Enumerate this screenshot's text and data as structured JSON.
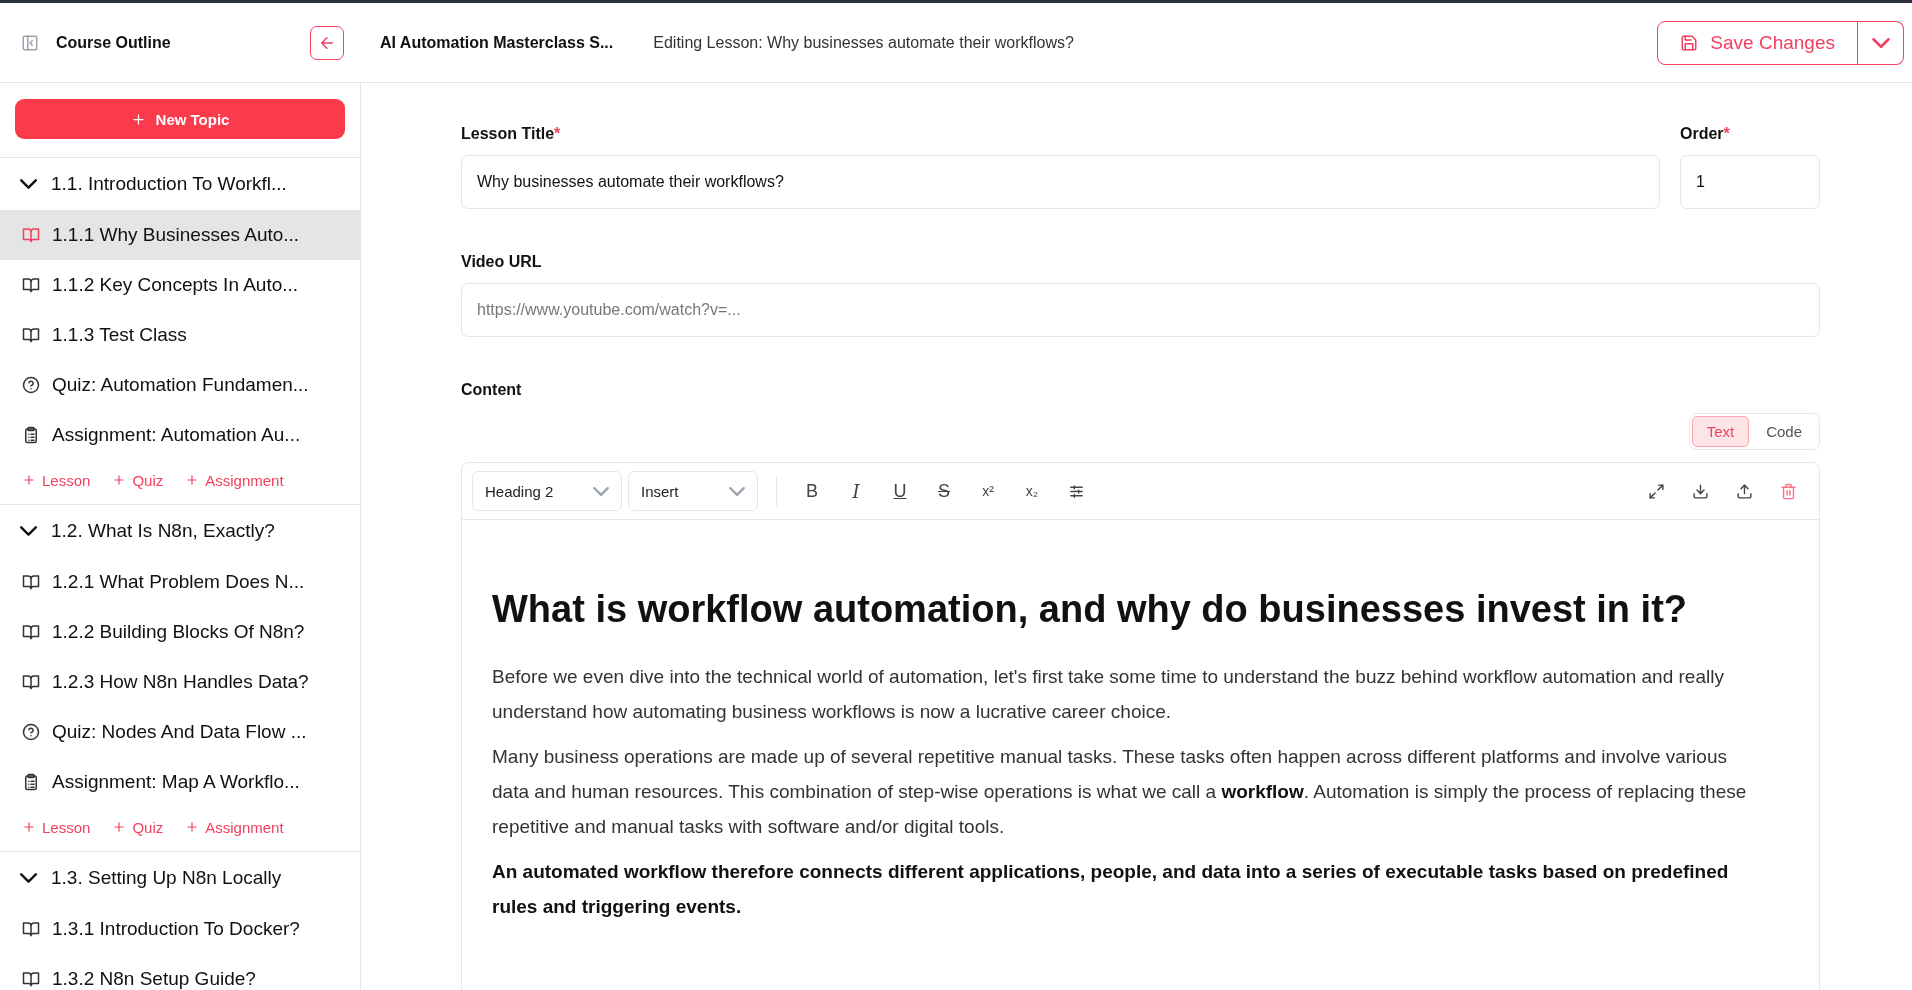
{
  "header": {
    "outline_title": "Course Outline",
    "course_title": "AI Automation Masterclass S...",
    "editing_label": "Editing Lesson: Why businesses automate their workflows?",
    "save_button": "Save Changes"
  },
  "sidebar": {
    "new_topic_button": "New Topic",
    "topics": [
      {
        "title": "1.1. Introduction To Workfl...",
        "expanded": true,
        "items": [
          {
            "kind": "lesson",
            "title": "1.1.1 Why Businesses Auto...",
            "selected": true
          },
          {
            "kind": "lesson",
            "title": "1.1.2 Key Concepts In Auto...",
            "selected": false
          },
          {
            "kind": "lesson",
            "title": "1.1.3 Test Class",
            "selected": false
          },
          {
            "kind": "quiz",
            "title": "Quiz: Automation Fundamen...",
            "selected": false
          },
          {
            "kind": "assignment",
            "title": "Assignment: Automation Au...",
            "selected": false
          }
        ],
        "add_actions": [
          "Lesson",
          "Quiz",
          "Assignment"
        ]
      },
      {
        "title": "1.2. What Is N8n, Exactly?",
        "expanded": true,
        "items": [
          {
            "kind": "lesson",
            "title": "1.2.1 What Problem Does N...",
            "selected": false
          },
          {
            "kind": "lesson",
            "title": "1.2.2 Building Blocks Of N8n?",
            "selected": false
          },
          {
            "kind": "lesson",
            "title": "1.2.3 How N8n Handles Data?",
            "selected": false
          },
          {
            "kind": "quiz",
            "title": "Quiz: Nodes And Data Flow ...",
            "selected": false
          },
          {
            "kind": "assignment",
            "title": "Assignment: Map A Workflo...",
            "selected": false
          }
        ],
        "add_actions": [
          "Lesson",
          "Quiz",
          "Assignment"
        ]
      },
      {
        "title": "1.3. Setting Up N8n Locally",
        "expanded": true,
        "items": [
          {
            "kind": "lesson",
            "title": "1.3.1 Introduction To Docker?",
            "selected": false
          },
          {
            "kind": "lesson",
            "title": "1.3.2 N8n Setup Guide?",
            "selected": false
          }
        ]
      }
    ]
  },
  "form": {
    "lesson_title": {
      "label": "Lesson Title",
      "required_mark": "*",
      "value": "Why businesses automate their workflows?"
    },
    "order": {
      "label": "Order",
      "required_mark": "*",
      "value": "1"
    },
    "video_url": {
      "label": "Video URL",
      "placeholder": "https://www.youtube.com/watch?v=..."
    },
    "content_label": "Content"
  },
  "editor": {
    "modes": [
      {
        "label": "Text",
        "selected": true
      },
      {
        "label": "Code",
        "selected": false
      }
    ],
    "dropdowns": [
      "Heading 2",
      "Insert"
    ],
    "format_buttons": [
      {
        "kind": "bold",
        "glyph": "B"
      },
      {
        "kind": "italic",
        "glyph": "I"
      },
      {
        "kind": "underline",
        "glyph": "U"
      },
      {
        "kind": "strike",
        "glyph": "S"
      },
      {
        "kind": "superscript",
        "glyph": "x²"
      },
      {
        "kind": "subscript",
        "glyph": "x₂"
      },
      {
        "kind": "settings"
      }
    ],
    "action_buttons": [
      {
        "kind": "fullscreen"
      },
      {
        "kind": "download"
      },
      {
        "kind": "upload"
      },
      {
        "kind": "delete"
      }
    ],
    "content": [
      {
        "kind": "heading",
        "text": "What is workflow automation, and why do businesses invest in it?"
      },
      {
        "kind": "paragraph",
        "text": "Before we even dive into the technical world of automation, let's first take some time to understand the buzz behind workflow automation and really understand how automating business workflows is now a lucrative career choice."
      },
      {
        "kind": "paragraph",
        "text": "Many business operations are made up of several repetitive manual tasks. These tasks often happen across different platforms and involve various data and human resources. This combination of step-wise operations is what we call a **workflow**. Automation is simply the process of replacing these repetitive and manual tasks with software and/or digital tools."
      },
      {
        "kind": "bold_paragraph",
        "text": "An automated workflow therefore connects different applications, people, and data into a series of executable tasks based on predefined rules and triggering events."
      }
    ]
  }
}
